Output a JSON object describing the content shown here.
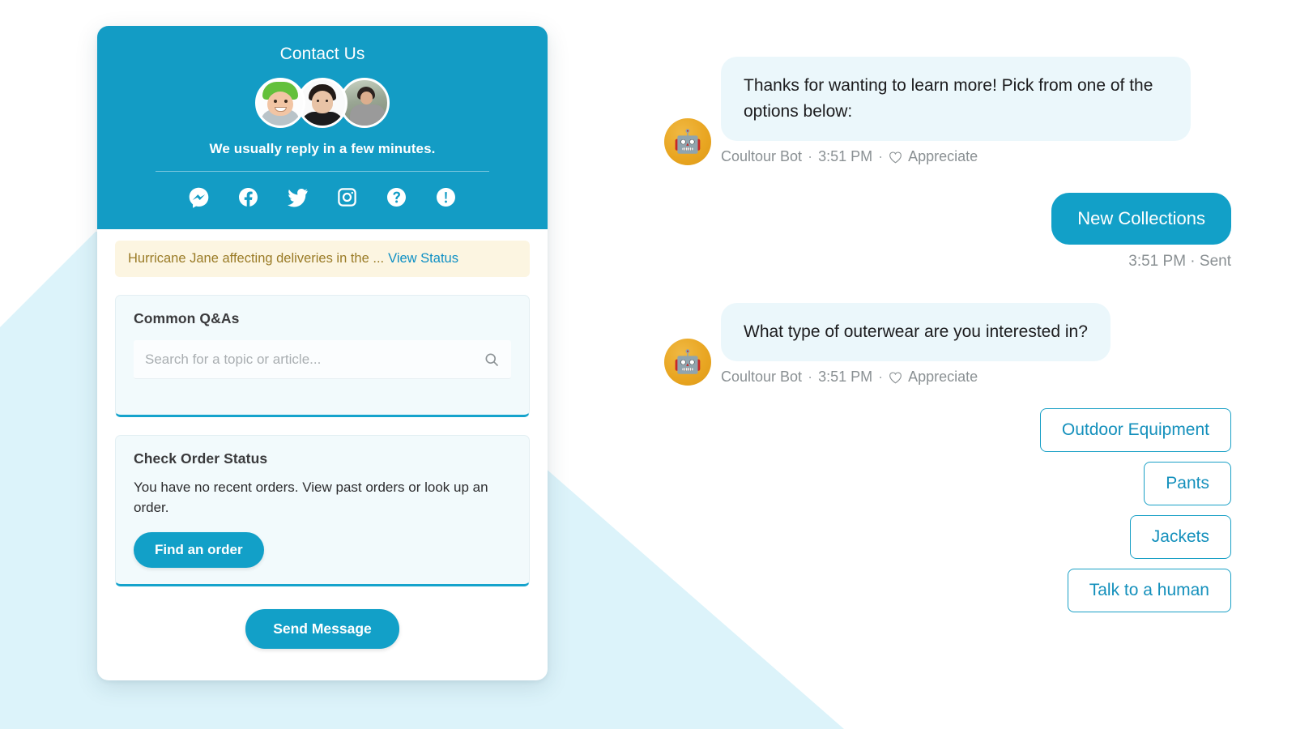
{
  "theme": {
    "brand_teal": "#12A0C8",
    "header_teal": "#139CC5",
    "bg_pale_blue": "#DCF3FA",
    "bubble_in_bg": "#EBF7FB",
    "panel_bg": "#F2FAFC",
    "alert_bg": "#FCF5E1",
    "alert_text": "#9A7B26",
    "link_blue": "#0D8FC4",
    "bot_avatar_orange": "#E9A622"
  },
  "widget": {
    "header": {
      "title": "Contact Us",
      "reply_note": "We usually reply in a few minutes.",
      "avatars": [
        {
          "name": "agent-avatar-1"
        },
        {
          "name": "agent-avatar-2"
        },
        {
          "name": "agent-avatar-3"
        }
      ],
      "social_icons": [
        {
          "name": "messenger-icon",
          "label": "Messenger"
        },
        {
          "name": "facebook-icon",
          "label": "Facebook"
        },
        {
          "name": "twitter-icon",
          "label": "Twitter"
        },
        {
          "name": "instagram-icon",
          "label": "Instagram"
        },
        {
          "name": "help-icon",
          "label": "Help"
        },
        {
          "name": "alert-icon",
          "label": "Alert"
        }
      ]
    },
    "alert": {
      "text": "Hurricane Jane affecting deliveries in the ...",
      "link": "View Status"
    },
    "qa_panel": {
      "title": "Common Q&As",
      "search_placeholder": "Search for a topic or article...",
      "search_value": "",
      "search_icon": "search-icon"
    },
    "order_panel": {
      "title": "Check Order Status",
      "description": "You have no recent orders. View past orders or look up an order.",
      "button_label": "Find an order"
    },
    "footer": {
      "send_message_label": "Send Message"
    }
  },
  "conversation": {
    "messages": [
      {
        "direction": "incoming",
        "text": "Thanks for wanting to learn more! Pick from one of the options below:",
        "sender": "Coultour Bot",
        "time": "3:51 PM",
        "separator": "·",
        "reaction_label": "Appreciate",
        "avatar_icon": "robot-icon",
        "avatar_glyph": "🤖"
      },
      {
        "direction": "outgoing",
        "text": "New Collections",
        "meta": "3:51 PM · Sent"
      },
      {
        "direction": "incoming",
        "text": "What type of outerwear are you interested in?",
        "sender": "Coultour Bot",
        "time": "3:51 PM",
        "separator": "·",
        "reaction_label": "Appreciate",
        "avatar_icon": "robot-icon",
        "avatar_glyph": "🤖"
      }
    ],
    "quick_replies": [
      {
        "label": "Outdoor Equipment"
      },
      {
        "label": "Pants"
      },
      {
        "label": "Jackets"
      },
      {
        "label": "Talk to a human"
      }
    ]
  }
}
